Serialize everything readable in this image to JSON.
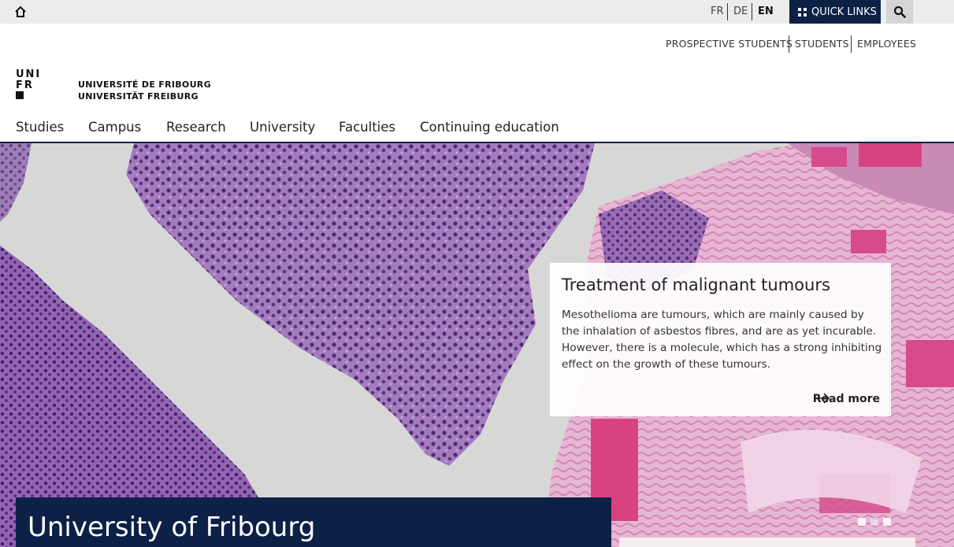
{
  "utility_bar": {
    "languages": [
      "FR",
      "DE",
      "EN"
    ],
    "active_language": "EN",
    "quick_links_label": "QUICK LINKS"
  },
  "audience_nav": {
    "items": [
      "PROSPECTIVE STUDENTS",
      "STUDENTS",
      "EMPLOYEES"
    ]
  },
  "logo": {
    "mark_lines": [
      "UNI",
      "FR"
    ],
    "line1": "UNIVERSITÉ DE FRIBOURG",
    "line2": "UNIVERSITÄT FREIBURG"
  },
  "main_nav": {
    "items": [
      "Studies",
      "Campus",
      "Research",
      "University",
      "Faculties",
      "Continuing education"
    ]
  },
  "hero": {
    "card": {
      "title": "Treatment of malignant tumours",
      "body": "Mesothelioma are tumours, which are mainly caused by the inhalation of asbestos fibres, and are as yet incurable. However, there is a molecule, which has a strong inhibiting effect on the growth of these tumours.",
      "link_label": "Read more"
    },
    "slide_count": 3,
    "active_slide": 2,
    "page_title": "University of Fribourg"
  },
  "colors": {
    "brand_navy": "#0d2147",
    "utility_bar": "#ececec",
    "tissue_purple": "#9a68b8",
    "tissue_pink": "#d64b8c"
  }
}
